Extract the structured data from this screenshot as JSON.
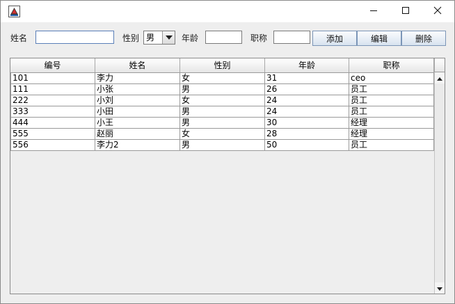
{
  "window": {
    "controls": [
      "minimize-icon",
      "maximize-icon",
      "close-icon"
    ]
  },
  "form": {
    "name_label": "姓名",
    "name_value": "",
    "gender_label": "性别",
    "gender_selected": "男",
    "age_label": "年龄",
    "age_value": "",
    "title_label": "职称",
    "title_value": "",
    "add_label": "添加",
    "edit_label": "编辑",
    "delete_label": "删除"
  },
  "table": {
    "headers": [
      "编号",
      "姓名",
      "性别",
      "年龄",
      "职称"
    ],
    "rows": [
      [
        "101",
        "李力",
        "女",
        "31",
        "ceo"
      ],
      [
        "111",
        "小张",
        "男",
        "26",
        "员工"
      ],
      [
        "222",
        "小刘",
        "女",
        "24",
        "员工"
      ],
      [
        "333",
        "小田",
        "男",
        "24",
        "员工"
      ],
      [
        "444",
        "小王",
        "男",
        "30",
        "经理"
      ],
      [
        "555",
        "赵丽",
        "女",
        "28",
        "经理"
      ],
      [
        "556",
        "李力2",
        "男",
        "50",
        "员工"
      ]
    ]
  },
  "colors": {
    "button_border": "#7b95b7",
    "titlebar_bg": "#ffffff",
    "window_bg": "#eeeeee"
  }
}
